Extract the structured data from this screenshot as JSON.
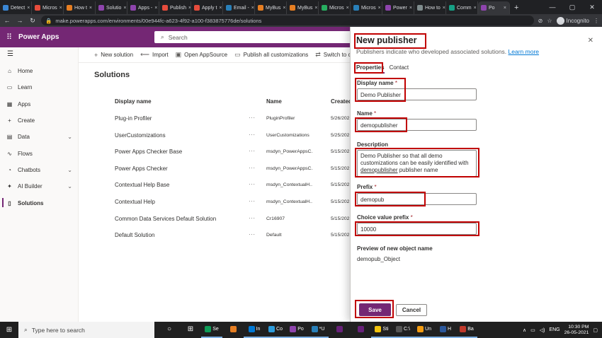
{
  "browser": {
    "tabs": [
      {
        "label": "Detect",
        "color": "#3a86d4"
      },
      {
        "label": "Micros",
        "color": "#e74c3c"
      },
      {
        "label": "How t",
        "color": "#e67e22"
      },
      {
        "label": "Solutio",
        "color": "#8e44ad"
      },
      {
        "label": "Apps -",
        "color": "#8e44ad"
      },
      {
        "label": "Publish",
        "color": "#e74c3c"
      },
      {
        "label": "Apply t",
        "color": "#e74c3c"
      },
      {
        "label": "Email -",
        "color": "#2980b9"
      },
      {
        "label": "MyBus",
        "color": "#e67e22"
      },
      {
        "label": "MyBus",
        "color": "#e67e22"
      },
      {
        "label": "Micros",
        "color": "#27ae60"
      },
      {
        "label": "Micros",
        "color": "#2980b9"
      },
      {
        "label": "Power",
        "color": "#8e44ad"
      },
      {
        "label": "How to",
        "color": "#7f8c8d"
      },
      {
        "label": "Comm",
        "color": "#16a085"
      },
      {
        "label": "Po",
        "color": "#8e44ad",
        "active": true
      }
    ],
    "new_tab": "+",
    "url": "make.powerapps.com/environments/00e944fc-a623-4f92-a100-f383875776de/solutions",
    "profile": "Incognito"
  },
  "app": {
    "title": "Power Apps",
    "search_placeholder": "Search"
  },
  "nav": {
    "items": [
      {
        "label": "Home",
        "icon": "home-icon",
        "glyph": "⌂"
      },
      {
        "label": "Learn",
        "icon": "book-icon",
        "glyph": "▭"
      },
      {
        "label": "Apps",
        "icon": "apps-icon",
        "glyph": "▦"
      },
      {
        "label": "Create",
        "icon": "plus-icon",
        "glyph": "+"
      },
      {
        "label": "Data",
        "icon": "database-icon",
        "glyph": "▤",
        "chevron": true
      },
      {
        "label": "Flows",
        "icon": "flow-icon",
        "glyph": "∿"
      },
      {
        "label": "Chatbots",
        "icon": "chatbot-icon",
        "glyph": "◔",
        "chevron": true
      },
      {
        "label": "AI Builder",
        "icon": "ai-builder-icon",
        "glyph": "✦",
        "chevron": true
      },
      {
        "label": "Solutions",
        "icon": "solutions-icon",
        "glyph": "▯",
        "selected": true
      }
    ]
  },
  "commands": [
    {
      "label": "New solution",
      "glyph": "+",
      "icon": "plus-icon"
    },
    {
      "label": "Import",
      "glyph": "⟵",
      "icon": "import-icon"
    },
    {
      "label": "Open AppSource",
      "glyph": "▣",
      "icon": "appsource-icon"
    },
    {
      "label": "Publish all customizations",
      "glyph": "▭",
      "icon": "publish-icon"
    },
    {
      "label": "Switch to cla",
      "glyph": "⇄",
      "icon": "switch-icon"
    }
  ],
  "main": {
    "title": "Solutions",
    "columns": {
      "display_name": "Display name",
      "name": "Name",
      "created": "Created"
    },
    "rows": [
      {
        "display_name": "Plug-in Profiler",
        "name": "PluginProfiler",
        "created": "5/26/202"
      },
      {
        "display_name": "UserCustomizations",
        "name": "UserCustomizations",
        "created": "5/25/202"
      },
      {
        "display_name": "Power Apps Checker Base",
        "name": "msdyn_PowerAppsC...",
        "created": "5/15/202"
      },
      {
        "display_name": "Power Apps Checker",
        "name": "msdyn_PowerAppsC...",
        "created": "5/15/202"
      },
      {
        "display_name": "Contextual Help Base",
        "name": "msdyn_ContextualH...",
        "created": "5/15/202"
      },
      {
        "display_name": "Contextual Help",
        "name": "msdyn_ContextualH...",
        "created": "5/15/202"
      },
      {
        "display_name": "Common Data Services Default Solution",
        "name": "Cr16907",
        "created": "5/15/202"
      },
      {
        "display_name": "Default Solution",
        "name": "Default",
        "created": "5/15/202"
      }
    ],
    "row_more": "···"
  },
  "panel": {
    "title": "New publisher",
    "description": "Publishers indicate who developed associated solutions.",
    "learn_more": "Learn more",
    "tabs": [
      "Properties",
      "Contact"
    ],
    "display_name": {
      "label": "Display name",
      "value": "Demo Publisher"
    },
    "name": {
      "label": "Name",
      "value": "demopublisher"
    },
    "description_field": {
      "label": "Description",
      "value_pre": "Demo Publisher so that all demo customizations can be easily identified with ",
      "value_underlined": "demopublisher",
      "value_post": " publisher name"
    },
    "prefix": {
      "label": "Prefix",
      "value": "demopub"
    },
    "choice_prefix": {
      "label": "Choice value prefix",
      "value": "10000"
    },
    "preview_label": "Preview of new object name",
    "preview_value": "demopub_Object",
    "required_mark": "*",
    "save": "Save",
    "cancel": "Cancel"
  },
  "taskbar": {
    "search_placeholder": "Type here to search",
    "apps": [
      {
        "label": "",
        "glyph": "○",
        "icon": "cortana-icon"
      },
      {
        "label": "",
        "glyph": "⊞",
        "icon": "task-view-icon"
      },
      {
        "label": "Se",
        "color": "#0f9d58",
        "icon": "edge-icon",
        "open": true
      },
      {
        "label": "",
        "color": "#e67e22",
        "icon": "file-explorer-icon"
      },
      {
        "label": "In",
        "color": "#0078d4",
        "icon": "outlook-icon",
        "open": true
      },
      {
        "label": "Co",
        "color": "#2d9cdb",
        "icon": "app-icon",
        "open": true
      },
      {
        "label": "Po",
        "color": "#8e44ad",
        "icon": "chrome-icon",
        "open": true
      },
      {
        "label": "*U",
        "color": "#2980b9",
        "icon": "app-icon",
        "open": true
      },
      {
        "label": "",
        "color": "#68217a",
        "icon": "visual-studio-icon"
      },
      {
        "label": "",
        "color": "#68217a",
        "icon": "visual-studio-icon"
      },
      {
        "label": "Sti",
        "color": "#f1c40f",
        "icon": "sticky-notes-icon",
        "open": true
      },
      {
        "label": "C:\\",
        "color": "#555555",
        "icon": "terminal-icon",
        "open": true
      },
      {
        "label": "Un",
        "color": "#f39c12",
        "icon": "folder-icon",
        "open": true
      },
      {
        "label": "H",
        "color": "#2b579a",
        "icon": "word-icon",
        "open": true
      },
      {
        "label": "Ba",
        "color": "#c0392b",
        "icon": "app-icon",
        "open": true
      }
    ],
    "lang": "ENG",
    "time": "10:30 PM",
    "date": "26-05-2021"
  }
}
